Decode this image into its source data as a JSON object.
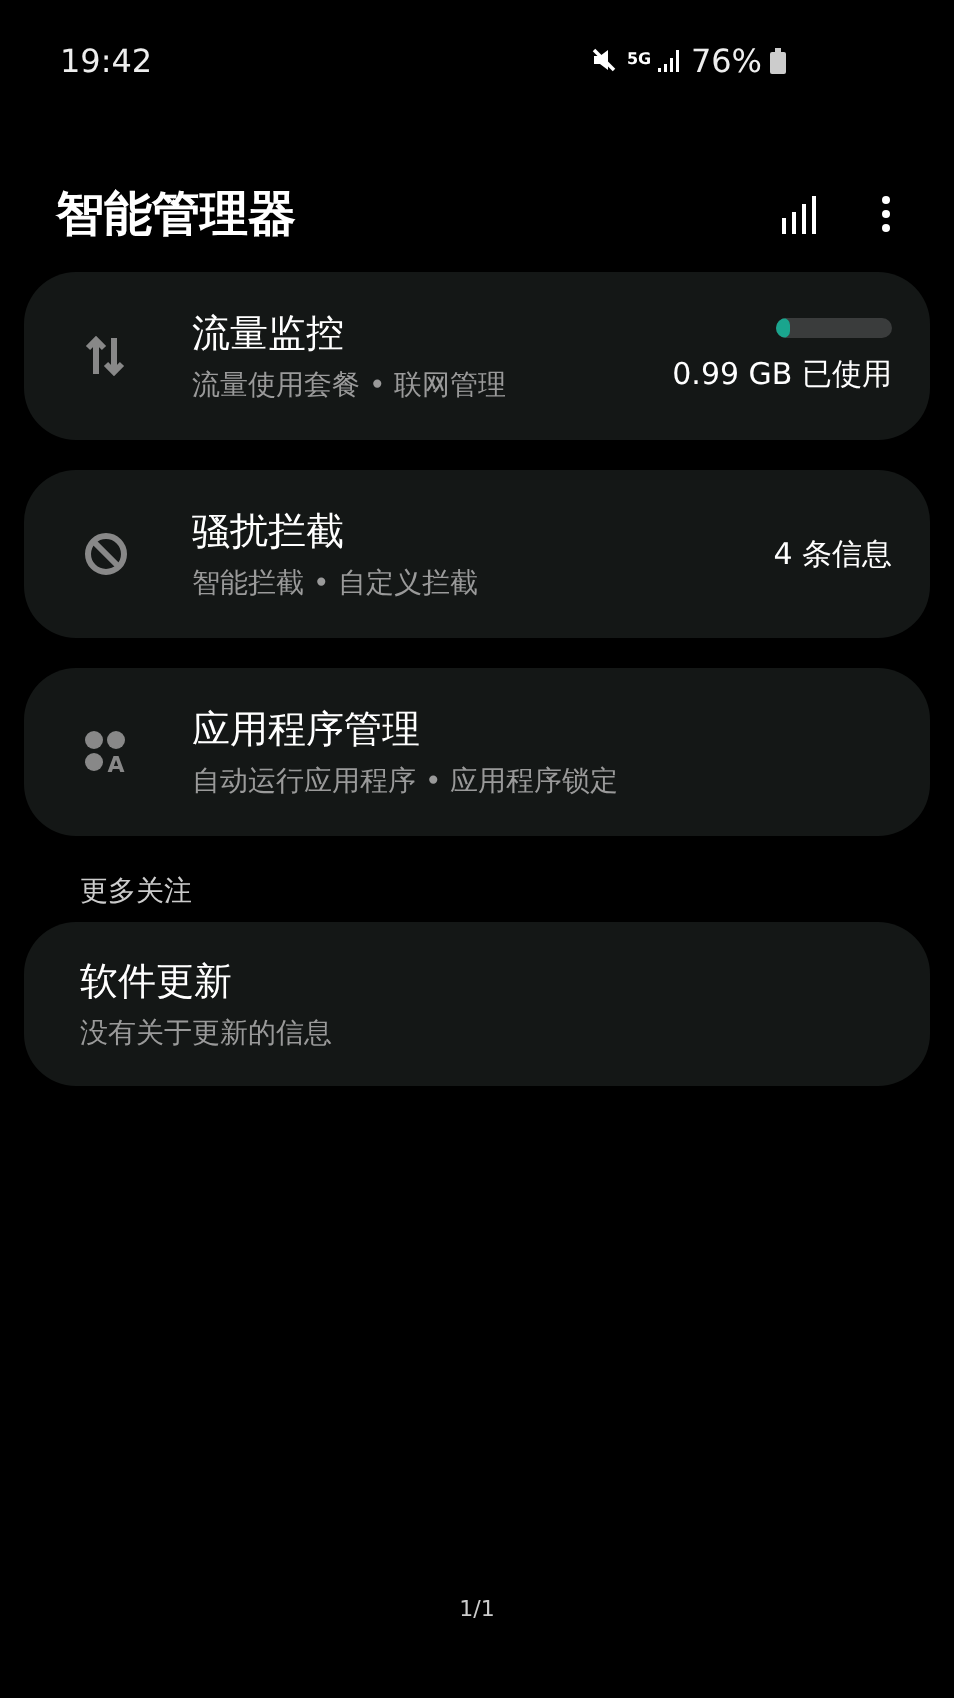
{
  "status_bar": {
    "time": "19:42",
    "network": "5G",
    "battery": "76%"
  },
  "header": {
    "title": "智能管理器"
  },
  "items": [
    {
      "title": "流量监控",
      "subtitle": "流量使用套餐 • 联网管理",
      "meter": {
        "level": 0.12
      },
      "value": "0.99 GB 已使用"
    },
    {
      "title": "骚扰拦截",
      "subtitle": "智能拦截 • 自定义拦截",
      "value": "4 条信息"
    },
    {
      "icon_letter": "A",
      "title": "应用程序管理",
      "subtitle": "自动运行应用程序 • 应用程序锁定"
    }
  ],
  "section": {
    "label": "更多关注",
    "items": [
      {
        "title": "软件更新",
        "subtitle": "没有关于更新的信息"
      }
    ]
  },
  "page_indicator": "1/1"
}
